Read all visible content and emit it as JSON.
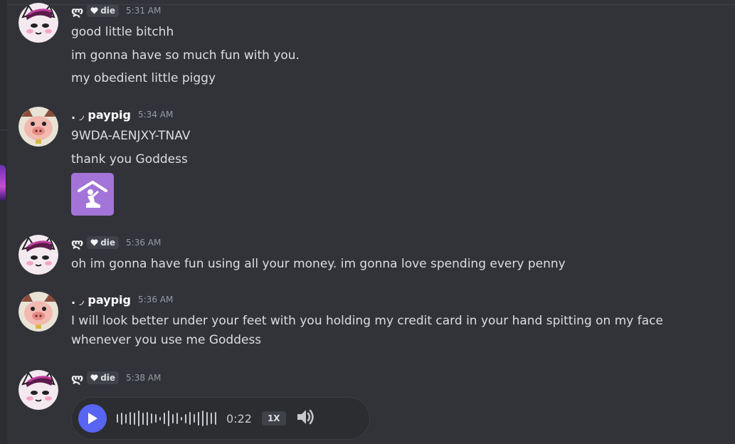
{
  "users": {
    "die": {
      "prefix": "ლ",
      "tag_label": "die"
    },
    "pig": {
      "name": ". ◞ paypig"
    }
  },
  "messages": [
    {
      "time": "5:31 AM",
      "lines": [
        "good little bitchh",
        "im gonna have so much fun with you.",
        "my obedient little piggy"
      ]
    },
    {
      "time": "5:34 AM",
      "lines": [
        "9WDA-AENJXY-TNAV",
        "thank you Goddess"
      ]
    },
    {
      "time": "5:36 AM",
      "lines": [
        "oh im gonna have fun using all your money. im gonna love spending every penny"
      ]
    },
    {
      "time": "5:36 AM",
      "lines": [
        "I will look better under your feet with you holding my credit card in your hand spitting on my face whenever you use me Goddess"
      ]
    },
    {
      "time": "5:38 AM"
    }
  ],
  "voice": {
    "duration": "0:22",
    "speed": "1X",
    "bars": [
      0.5,
      0.7,
      0.55,
      0.75,
      0.7,
      0.9,
      0.7,
      0.8,
      0.6,
      0.5,
      0.2,
      0.65,
      0.9,
      0.55,
      0.65,
      0.2,
      0.55,
      0.75,
      0.5,
      0.8,
      0.9,
      0.8,
      0.65,
      0.75
    ]
  },
  "colors": {
    "accent": "#5865f2",
    "background": "#323339",
    "emoji_bg": "#a374d8"
  },
  "icons": {
    "tag_icon": "heart-icon",
    "emoji": "person-in-house-emoji",
    "play": "play-icon",
    "volume": "volume-icon"
  }
}
